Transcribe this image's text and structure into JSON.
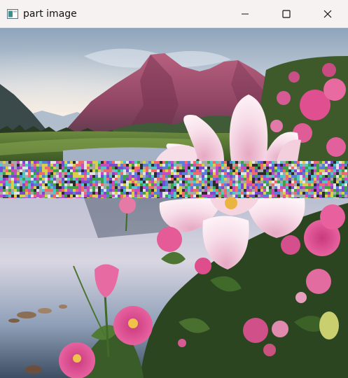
{
  "window": {
    "title": "part image",
    "icon": "image-window-icon",
    "controls": [
      {
        "name": "minimize-button",
        "icon": "minimize-icon"
      },
      {
        "name": "maximize-button",
        "icon": "maximize-icon"
      },
      {
        "name": "close-button",
        "icon": "close-icon"
      }
    ]
  },
  "image": {
    "subject": "mountains-lake-pink-flowers",
    "noise_band": true
  },
  "colors": {
    "titlebar": "#f7f2f2",
    "sky_top": "#8fa6bd",
    "sky_glow": "#f3e6dc",
    "mountain": "#9a4e6a",
    "lake": "#a7b2c6",
    "foliage": "#2f4a22",
    "petal_pink": "#e4579a",
    "petal_light": "#f7d6e2"
  }
}
